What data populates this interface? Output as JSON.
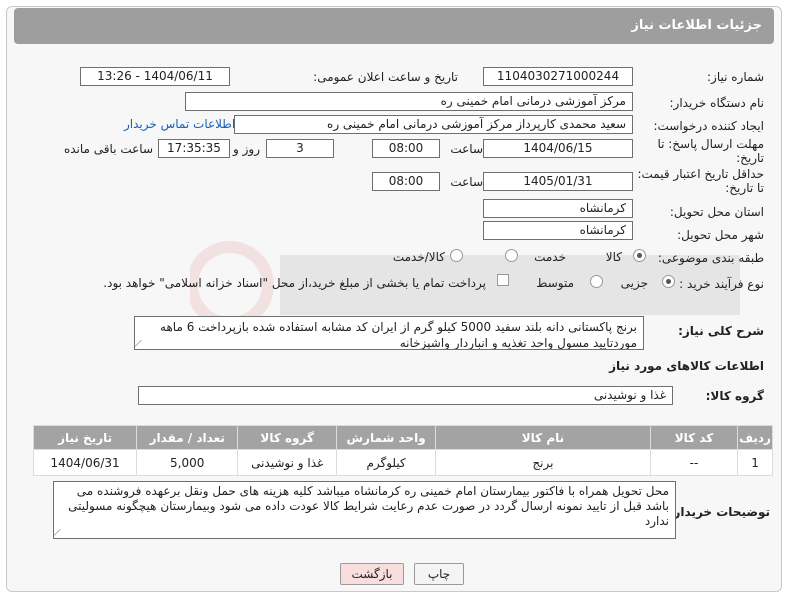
{
  "header": {
    "title": "جزئیات اطلاعات نیاز"
  },
  "form": {
    "need_number_label": "شماره نیاز:",
    "need_number": "1104030271000244",
    "announce_label": "تاریخ و ساعت اعلان عمومی:",
    "announce_value": "1404/06/11 - 13:26",
    "buyer_org_label": "نام دستگاه خریدار:",
    "buyer_org": "مرکز آموزشی درمانی امام خمینی ره",
    "creator_label": "ایجاد کننده درخواست:",
    "creator": "سعید محمدی کارپرداز مرکز آموزشی درمانی امام خمینی ره",
    "contact_link": "اطلاعات تماس خریدار",
    "deadline_label_1": "مهلت ارسال پاسخ: تا",
    "deadline_label_2": "تاریخ:",
    "deadline_date": "1404/06/15",
    "time_label": "ساعت",
    "deadline_time": "08:00",
    "days_value": "3",
    "days_label": "روز و",
    "remaining_time": "17:35:35",
    "remaining_label": "ساعت باقی مانده",
    "validity_label_1": "حداقل تاریخ اعتبار قیمت:",
    "validity_label_2": "تا تاریخ:",
    "validity_date": "1405/01/31",
    "validity_time_label": "ساعت",
    "validity_time": "08:00",
    "province_label": "استان محل تحویل:",
    "province": "کرمانشاه",
    "city_label": "شهر محل تحویل:",
    "city": "کرمانشاه",
    "category_label": "طبقه بندی موضوعی:",
    "category_options": [
      "کالا",
      "خدمت",
      "کالا/خدمت"
    ],
    "category_selected": "کالا",
    "process_label": "نوع فرآیند خرید :",
    "process_options": [
      "جزیی",
      "متوسط"
    ],
    "process_selected": "جزیی",
    "payment_note": "پرداخت تمام یا بخشی از مبلغ خرید،از محل \"اسناد خزانه اسلامی\" خواهد بود.",
    "description_label": "شرح کلی نیاز:",
    "description": "برنج پاکستانی دانه بلند سفید 5000 کیلو گرم از ایران کد مشابه استفاده شده بازپرداخت 6 ماهه موردتایید مسول واحد تغذیه و انباردار واشپزخانه"
  },
  "goods_section": {
    "title": "اطلاعات کالاهای مورد نیاز",
    "group_label": "گروه کالا:",
    "group_value": "غذا و نوشیدنی"
  },
  "table": {
    "headers": [
      "ردیف",
      "کد کالا",
      "نام کالا",
      "واحد شمارش",
      "گروه کالا",
      "تعداد / مقدار",
      "تاریخ نیاز"
    ],
    "rows": [
      [
        "1",
        "--",
        "برنج",
        "کیلوگرم",
        "غذا و نوشیدنی",
        "5,000",
        "1404/06/31"
      ]
    ]
  },
  "buyer_notes": {
    "label": "توضیحات خریدار:",
    "text": "محل تحویل همراه با فاکتور بیمارستان امام خمینی ره کرمانشاه میباشد کلیه هزینه های حمل ونقل برعهده فروشنده می باشد  قبل از تایید نمونه ارسال گردد در صورت عدم رعایت شرایط کالا عودت داده می شود وبیمارستان هیچگونه مسولیتی ندارد"
  },
  "buttons": {
    "print": "چاپ",
    "back": "بازگشت"
  }
}
